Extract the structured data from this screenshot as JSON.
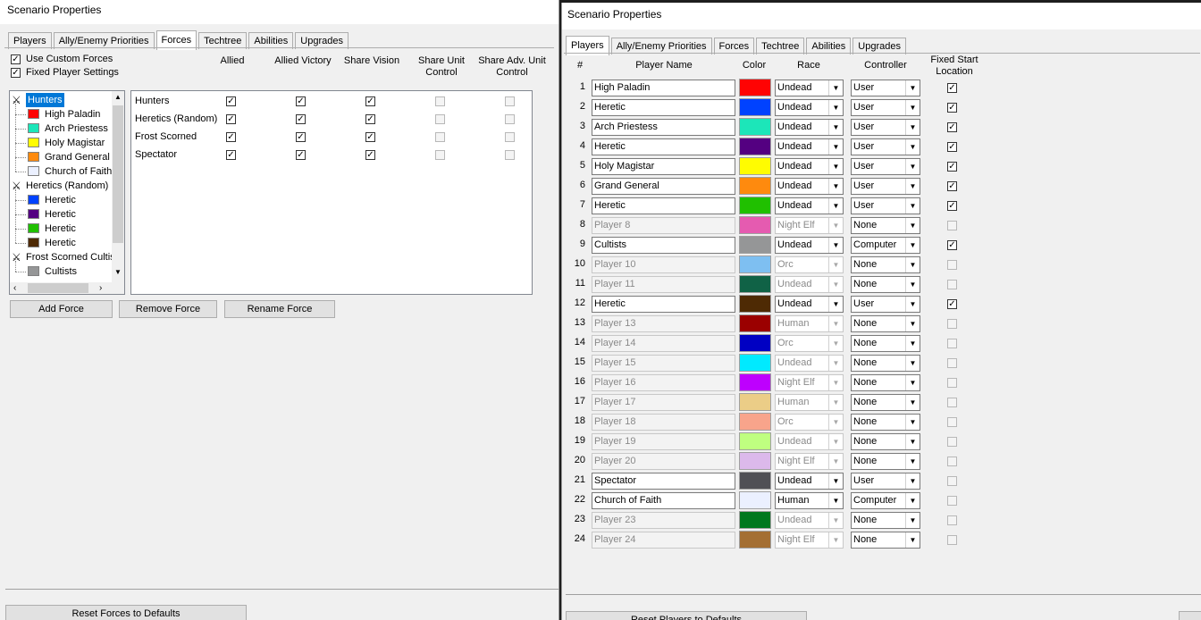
{
  "left": {
    "title": "Scenario Properties",
    "tabs": [
      "Players",
      "Ally/Enemy Priorities",
      "Forces",
      "Techtree",
      "Abilities",
      "Upgrades"
    ],
    "active_tab": "Forces",
    "options": [
      {
        "label": "Use Custom Forces",
        "checked": true
      },
      {
        "label": "Fixed Player Settings",
        "checked": true
      }
    ],
    "headers": {
      "allied": "Allied",
      "allied_victory": "Allied Victory",
      "share_vision": "Share Vision",
      "share_unit_control": "Share Unit Control",
      "share_adv_unit_control": "Share Adv. Unit Control"
    },
    "tree": [
      {
        "type": "force",
        "label": "Hunters",
        "selected": true
      },
      {
        "type": "player",
        "label": "High Paladin",
        "color": "#ff0303"
      },
      {
        "type": "player",
        "label": "Arch Priestess",
        "color": "#1ce6b9"
      },
      {
        "type": "player",
        "label": "Holy Magistar",
        "color": "#fffc01"
      },
      {
        "type": "player",
        "label": "Grand General",
        "color": "#fe8a0e"
      },
      {
        "type": "player",
        "label": "Church of Faith",
        "color": "#ebf0ff"
      },
      {
        "type": "force",
        "label": "Heretics (Random)",
        "selected": false
      },
      {
        "type": "player",
        "label": "Heretic",
        "color": "#0042ff"
      },
      {
        "type": "player",
        "label": "Heretic",
        "color": "#540081"
      },
      {
        "type": "player",
        "label": "Heretic",
        "color": "#20c000"
      },
      {
        "type": "player",
        "label": "Heretic",
        "color": "#4e2a04"
      },
      {
        "type": "force",
        "label": "Frost Scorned Cultis",
        "selected": false
      },
      {
        "type": "player",
        "label": "Cultists",
        "color": "#959697"
      }
    ],
    "forces": [
      {
        "name": "Hunters",
        "flags": [
          true,
          true,
          true,
          false,
          false
        ]
      },
      {
        "name": "Heretics (Random)",
        "flags": [
          true,
          true,
          true,
          false,
          false
        ]
      },
      {
        "name": "Frost Scorned",
        "flags": [
          true,
          true,
          true,
          false,
          false
        ]
      },
      {
        "name": "Spectator",
        "flags": [
          true,
          true,
          true,
          false,
          false
        ]
      }
    ],
    "buttons": {
      "add": "Add Force",
      "remove": "Remove Force",
      "rename": "Rename Force",
      "reset": "Reset Forces to Defaults"
    }
  },
  "right": {
    "title": "Scenario Properties",
    "tabs": [
      "Players",
      "Ally/Enemy Priorities",
      "Forces",
      "Techtree",
      "Abilities",
      "Upgrades"
    ],
    "active_tab": "Players",
    "headers": {
      "num": "#",
      "name": "Player Name",
      "color": "Color",
      "race": "Race",
      "controller": "Controller",
      "fixed": "Fixed Start Location"
    },
    "players": [
      {
        "num": "1",
        "name": "High Paladin",
        "color": "#ff0303",
        "race": "Undead",
        "controller": "User",
        "fixed": true,
        "enabled": true
      },
      {
        "num": "2",
        "name": "Heretic",
        "color": "#0042ff",
        "race": "Undead",
        "controller": "User",
        "fixed": true,
        "enabled": true
      },
      {
        "num": "3",
        "name": "Arch Priestess",
        "color": "#1ce6b9",
        "race": "Undead",
        "controller": "User",
        "fixed": true,
        "enabled": true
      },
      {
        "num": "4",
        "name": "Heretic",
        "color": "#540081",
        "race": "Undead",
        "controller": "User",
        "fixed": true,
        "enabled": true
      },
      {
        "num": "5",
        "name": "Holy Magistar",
        "color": "#fffc01",
        "race": "Undead",
        "controller": "User",
        "fixed": true,
        "enabled": true
      },
      {
        "num": "6",
        "name": "Grand General",
        "color": "#fe8a0e",
        "race": "Undead",
        "controller": "User",
        "fixed": true,
        "enabled": true
      },
      {
        "num": "7",
        "name": "Heretic",
        "color": "#20c000",
        "race": "Undead",
        "controller": "User",
        "fixed": true,
        "enabled": true
      },
      {
        "num": "8",
        "name": "Player 8",
        "color": "#e55bb0",
        "race": "Night Elf",
        "controller": "None",
        "fixed": false,
        "enabled": false
      },
      {
        "num": "9",
        "name": "Cultists",
        "color": "#959697",
        "race": "Undead",
        "controller": "Computer",
        "fixed": true,
        "enabled": true
      },
      {
        "num": "10",
        "name": "Player 10",
        "color": "#7ebff1",
        "race": "Orc",
        "controller": "None",
        "fixed": false,
        "enabled": false
      },
      {
        "num": "11",
        "name": "Player 11",
        "color": "#106246",
        "race": "Undead",
        "controller": "None",
        "fixed": false,
        "enabled": false
      },
      {
        "num": "12",
        "name": "Heretic",
        "color": "#4e2a04",
        "race": "Undead",
        "controller": "User",
        "fixed": true,
        "enabled": true
      },
      {
        "num": "13",
        "name": "Player 13",
        "color": "#9b0000",
        "race": "Human",
        "controller": "None",
        "fixed": false,
        "enabled": false
      },
      {
        "num": "14",
        "name": "Player 14",
        "color": "#0000c3",
        "race": "Orc",
        "controller": "None",
        "fixed": false,
        "enabled": false
      },
      {
        "num": "15",
        "name": "Player 15",
        "color": "#00eaff",
        "race": "Undead",
        "controller": "None",
        "fixed": false,
        "enabled": false
      },
      {
        "num": "16",
        "name": "Player 16",
        "color": "#be00fe",
        "race": "Night Elf",
        "controller": "None",
        "fixed": false,
        "enabled": false
      },
      {
        "num": "17",
        "name": "Player 17",
        "color": "#ebcd87",
        "race": "Human",
        "controller": "None",
        "fixed": false,
        "enabled": false
      },
      {
        "num": "18",
        "name": "Player 18",
        "color": "#f8a48b",
        "race": "Orc",
        "controller": "None",
        "fixed": false,
        "enabled": false
      },
      {
        "num": "19",
        "name": "Player 19",
        "color": "#bfff80",
        "race": "Undead",
        "controller": "None",
        "fixed": false,
        "enabled": false
      },
      {
        "num": "20",
        "name": "Player 20",
        "color": "#dcb9eb",
        "race": "Night Elf",
        "controller": "None",
        "fixed": false,
        "enabled": false
      },
      {
        "num": "21",
        "name": "Spectator",
        "color": "#505055",
        "race": "Undead",
        "controller": "User",
        "fixed": false,
        "enabled": true
      },
      {
        "num": "22",
        "name": "Church of Faith",
        "color": "#ebf0ff",
        "race": "Human",
        "controller": "Computer",
        "fixed": false,
        "enabled": true
      },
      {
        "num": "23",
        "name": "Player 23",
        "color": "#00781e",
        "race": "Undead",
        "controller": "None",
        "fixed": false,
        "enabled": false
      },
      {
        "num": "24",
        "name": "Player 24",
        "color": "#a46f33",
        "race": "Night Elf",
        "controller": "None",
        "fixed": false,
        "enabled": false
      }
    ],
    "reset_label": "Reset Players to Defaults"
  }
}
